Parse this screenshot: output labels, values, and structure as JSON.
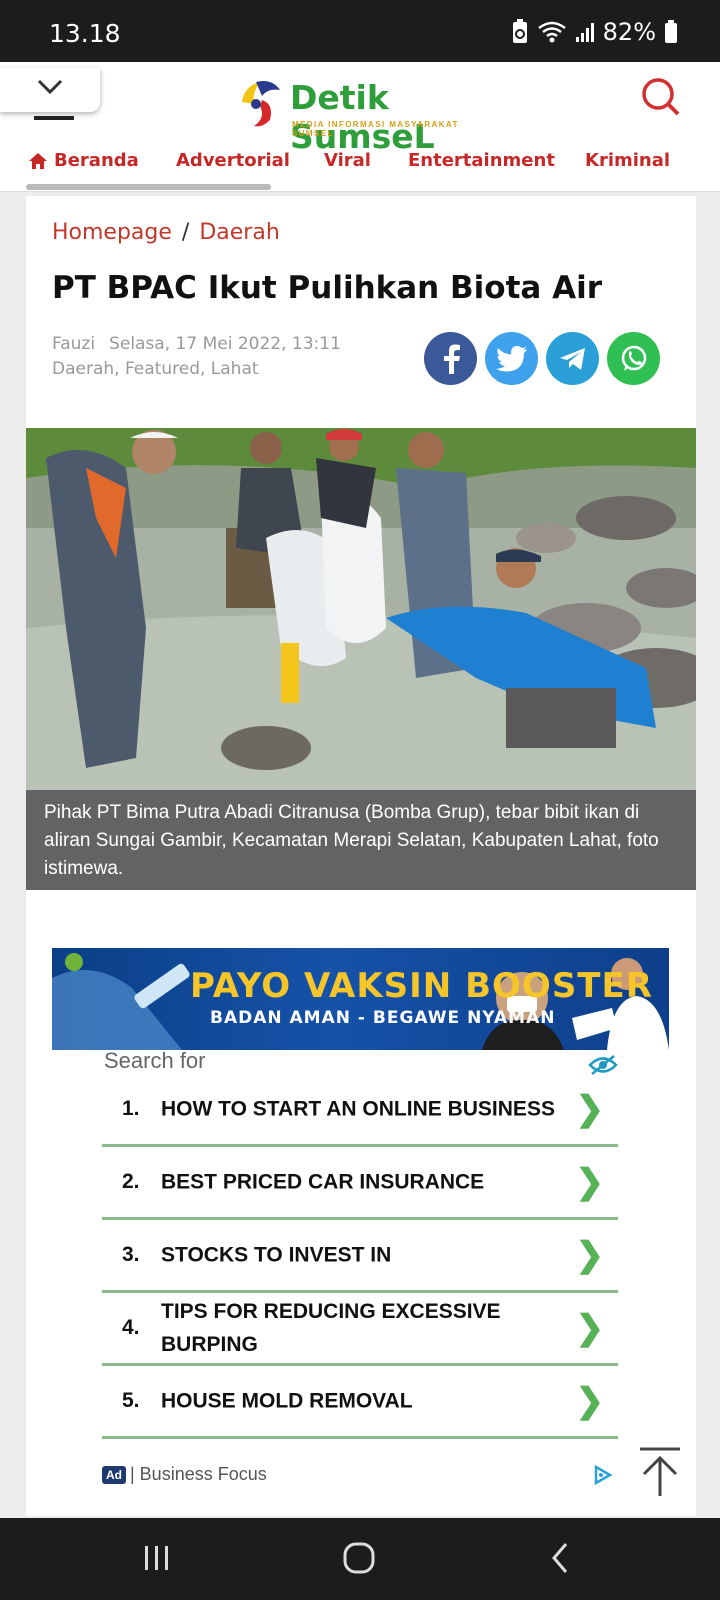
{
  "status": {
    "time": "13.18",
    "battery": "82%"
  },
  "header": {
    "logo_title": "Detik SumseL",
    "logo_tagline": "MEDIA INFORMASI MASYARAKAT SUMSEL",
    "nav": [
      {
        "label": "Beranda"
      },
      {
        "label": "Advertorial"
      },
      {
        "label": "Viral"
      },
      {
        "label": "Entertainment"
      },
      {
        "label": "Kriminal"
      }
    ]
  },
  "article": {
    "breadcrumb": [
      "Homepage",
      "Daerah"
    ],
    "breadcrumb_sep": "/",
    "title": "PT BPAC Ikut Pulihkan Biota Air",
    "author": "Fauzi",
    "date": "Selasa, 17 Mei 2022, 13:11",
    "categories": "Daerah, Featured, Lahat",
    "caption": "Pihak PT Bima Putra Abadi Citranusa (Bomba Grup), tebar bibit ikan di aliran Sungai Gambir, Kecamatan Merapi Selatan, Kabupaten Lahat, foto istimewa."
  },
  "banner": {
    "headline": "PAYO VAKSIN BOOSTER",
    "sub": "BADAN AMAN - BEGAWE NYAMAN"
  },
  "search_ad": {
    "label": "Search for",
    "items": [
      {
        "num": "1.",
        "text": "HOW TO START AN ONLINE BUSINESS"
      },
      {
        "num": "2.",
        "text": "BEST PRICED CAR INSURANCE"
      },
      {
        "num": "3.",
        "text": "STOCKS TO INVEST IN"
      },
      {
        "num": "4.",
        "text": "TIPS FOR REDUCING EXCESSIVE BURPING"
      },
      {
        "num": "5.",
        "text": "HOUSE MOLD REMOVAL"
      }
    ],
    "arrow": "❯",
    "ad_tag": "Ad",
    "ad_source": "| Business Focus"
  },
  "colors": {
    "brand_red": "#c62828",
    "logo_green": "#2e9e3a",
    "list_rule": "#8cb88c",
    "facebook": "#3b5998",
    "twitter": "#3ea1ec",
    "telegram": "#2a9fd8",
    "whatsapp": "#2fbf52"
  }
}
